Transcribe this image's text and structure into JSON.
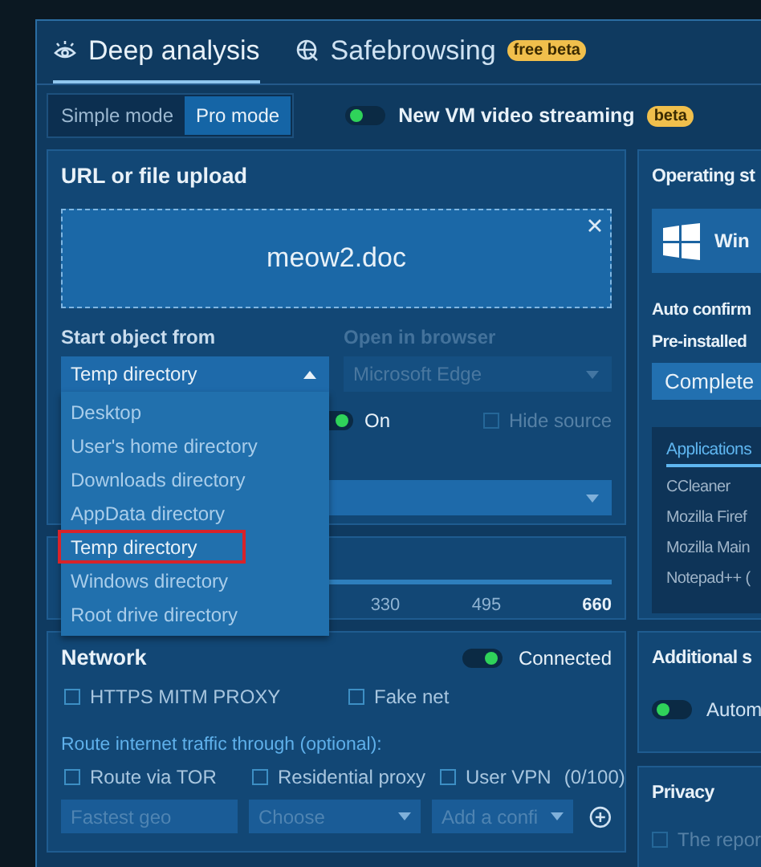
{
  "tabs": [
    {
      "kind": "eye",
      "label": "Deep analysis",
      "selected": true
    },
    {
      "kind": "globe",
      "label": "Safebrowsing",
      "selected": false,
      "badge": "free beta"
    }
  ],
  "modes": [
    {
      "label": "Simple mode",
      "selected": false
    },
    {
      "label": "Pro mode",
      "selected": true
    }
  ],
  "video_streaming": {
    "label": "New VM video streaming",
    "on": false,
    "badge": "beta"
  },
  "upload": {
    "title": "URL or file upload",
    "file": "meow2.doc"
  },
  "start_object": {
    "label": "Start object from",
    "value": "Temp directory",
    "expanded": true,
    "options": [
      {
        "label": "Desktop",
        "selected": false
      },
      {
        "label": "User's home directory",
        "selected": false
      },
      {
        "label": "Downloads directory",
        "selected": false
      },
      {
        "label": "AppData directory",
        "selected": false
      },
      {
        "label": "Temp directory",
        "selected": true
      },
      {
        "label": "Windows directory",
        "selected": false
      },
      {
        "label": "Root drive directory",
        "selected": false
      }
    ]
  },
  "browser": {
    "label": "Open in browser",
    "value": "Microsoft Edge",
    "disabled": true
  },
  "autostart": {
    "label": "On",
    "on": true
  },
  "hide_source": {
    "label": "Hide source",
    "checked": false,
    "disabled": true
  },
  "timeout": {
    "ticks": [
      {
        "label": "330",
        "selected": false
      },
      {
        "label": "495",
        "selected": false
      },
      {
        "label": "660",
        "selected": true
      }
    ]
  },
  "network": {
    "title": "Network",
    "connection": {
      "label": "Connected",
      "on": true
    },
    "options": [
      {
        "label": "HTTPS MITM PROXY",
        "checked": false
      },
      {
        "label": "Fake net",
        "checked": false
      }
    ],
    "route_label": "Route internet traffic through (optional):",
    "routes": [
      {
        "label": "Route via TOR",
        "checked": false
      },
      {
        "label": "Residential proxy",
        "checked": false
      },
      {
        "label": "User VPN",
        "checked": false,
        "count": "(0/100)"
      }
    ],
    "fields": [
      {
        "kind": "input",
        "placeholder": "Fastest geo"
      },
      {
        "kind": "select",
        "placeholder": "Choose"
      },
      {
        "kind": "select",
        "placeholder": "Add a confi"
      }
    ]
  },
  "os": {
    "title": "Operating st",
    "system": "Win",
    "auto_confirm": "Auto confirm",
    "preinstalled": "Pre-installed",
    "preset": "Complete",
    "apps_tab": "Applications",
    "apps": [
      "CCleaner",
      "Mozilla Firef",
      "Mozilla Main",
      "Notepad++ ("
    ]
  },
  "additional": {
    "title": "Additional s",
    "toggle": {
      "label": "Autom",
      "on": false
    }
  },
  "privacy": {
    "title": "Privacy",
    "option": {
      "label": "The repor",
      "checked": false,
      "disabled": true
    }
  }
}
